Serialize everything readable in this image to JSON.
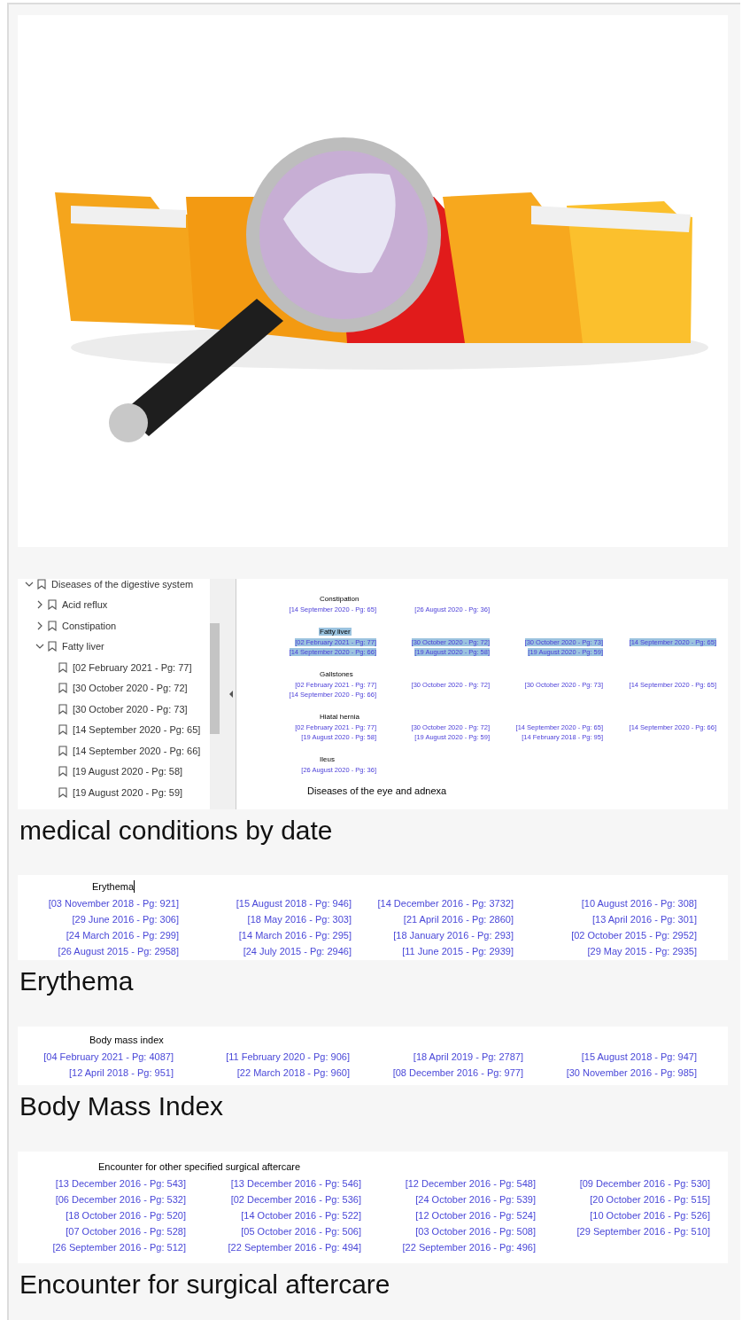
{
  "viewer": {
    "tree": [
      {
        "label": "Diseases of the digestive system",
        "kind": "folder",
        "expanded": true,
        "children": [
          {
            "label": "Acid reflux",
            "kind": "folder",
            "expanded": false
          },
          {
            "label": "Constipation",
            "kind": "folder",
            "expanded": false
          },
          {
            "label": "Fatty liver",
            "kind": "folder",
            "expanded": true,
            "children": [
              {
                "label": "[02 February 2021 - Pg: 77]",
                "kind": "entry"
              },
              {
                "label": "[30 October 2020 - Pg: 72]",
                "kind": "entry"
              },
              {
                "label": "[30 October 2020 - Pg: 73]",
                "kind": "entry"
              },
              {
                "label": "[14 September 2020 - Pg: 65]",
                "kind": "entry"
              },
              {
                "label": "[14 September 2020 - Pg: 66]",
                "kind": "entry"
              },
              {
                "label": "[19 August 2020 - Pg: 58]",
                "kind": "entry"
              },
              {
                "label": "[19 August 2020 - Pg: 59]",
                "kind": "entry"
              }
            ]
          }
        ]
      }
    ],
    "document": {
      "groups": [
        {
          "title": "Constipation",
          "selected": false,
          "entries": [
            "[14 September 2020 - Pg: 65]",
            "[26 August 2020 - Pg: 36]"
          ]
        },
        {
          "title": "Fatty liver",
          "selected": true,
          "entries": [
            "[02 February 2021 - Pg: 77]",
            "[30 October 2020 - Pg: 72]",
            "[30 October 2020 - Pg: 73]",
            "[14 September 2020 - Pg: 65]",
            "[14 September 2020 - Pg: 66]",
            "[19 August 2020 - Pg: 58]",
            "[19 August 2020 - Pg: 59]"
          ]
        },
        {
          "title": "Gallstones",
          "selected": false,
          "entries": [
            "[02 February 2021 - Pg: 77]",
            "[30 October 2020 - Pg: 72]",
            "[30 October 2020 - Pg: 73]",
            "[14 September 2020 - Pg: 65]",
            "[14 September 2020 - Pg: 66]"
          ]
        },
        {
          "title": "Hiatal hernia",
          "selected": false,
          "entries": [
            "[02 February 2021 - Pg: 77]",
            "[30 October 2020 - Pg: 72]",
            "[14 September 2020 - Pg: 65]",
            "[14 September 2020 - Pg: 66]",
            "[19 August 2020 - Pg: 58]",
            "[19 August 2020 - Pg: 59]",
            "[14 February 2018 - Pg: 95]"
          ]
        },
        {
          "title": "Ileus",
          "selected": false,
          "entries": [
            "[26 August 2020 - Pg: 36]"
          ]
        }
      ],
      "section_heading": "Diseases of the eye and adnexa"
    },
    "caption": "medical conditions by date"
  },
  "indexes": [
    {
      "heading": "Erythema",
      "cursor": true,
      "entries": [
        "[03 November 2018 - Pg: 921]",
        "[15 August 2018 - Pg: 946]",
        "[14 December 2016 - Pg: 3732]",
        "[10 August 2016 - Pg: 308]",
        "[29 June 2016 - Pg: 306]",
        "[18 May 2016 - Pg: 303]",
        "[21 April 2016 - Pg: 2860]",
        "[13 April 2016 - Pg: 301]",
        "[24 March 2016 - Pg: 299]",
        "[14 March 2016 - Pg: 295]",
        "[18 January 2016 - Pg: 293]",
        "[02 October 2015 - Pg: 2952]",
        "[26 August 2015 - Pg: 2958]",
        "[24 July 2015 - Pg: 2946]",
        "[11 June 2015 - Pg: 2939]",
        "[29 May 2015 - Pg: 2935]"
      ],
      "caption": "Erythema"
    },
    {
      "heading": "Body mass index",
      "cursor": false,
      "entries": [
        "[04 February 2021 - Pg: 4087]",
        "[11 February 2020 - Pg: 906]",
        "[18 April 2019 - Pg: 2787]",
        "[15 August 2018 - Pg: 947]",
        "[12 April 2018 - Pg: 951]",
        "[22 March 2018 - Pg: 960]",
        "[08 December 2016 - Pg: 977]",
        "[30 November 2016 - Pg: 985]"
      ],
      "caption": "Body Mass Index"
    },
    {
      "heading": "Encounter for other specified surgical aftercare",
      "cursor": false,
      "entries": [
        "[13 December 2016 - Pg: 543]",
        "[13 December 2016 - Pg: 546]",
        "[12 December 2016 - Pg: 548]",
        "[09 December 2016 - Pg: 530]",
        "[06 December 2016 - Pg: 532]",
        "[02 December 2016 - Pg: 536]",
        "[24 October 2016 - Pg: 539]",
        "[20 October 2016 - Pg: 515]",
        "[18 October 2016 - Pg: 520]",
        "[14 October 2016 - Pg: 522]",
        "[12 October 2016 - Pg: 524]",
        "[10 October 2016 - Pg: 526]",
        "[07 October 2016 - Pg: 528]",
        "[05 October 2016 - Pg: 506]",
        "[03 October 2016 - Pg: 508]",
        "[29 September 2016 - Pg: 510]",
        "[26 September 2016 - Pg: 512]",
        "[22 September 2016 - Pg: 494]",
        "[22 September 2016 - Pg: 496]"
      ],
      "caption": "Encounter for surgical aftercare"
    }
  ]
}
